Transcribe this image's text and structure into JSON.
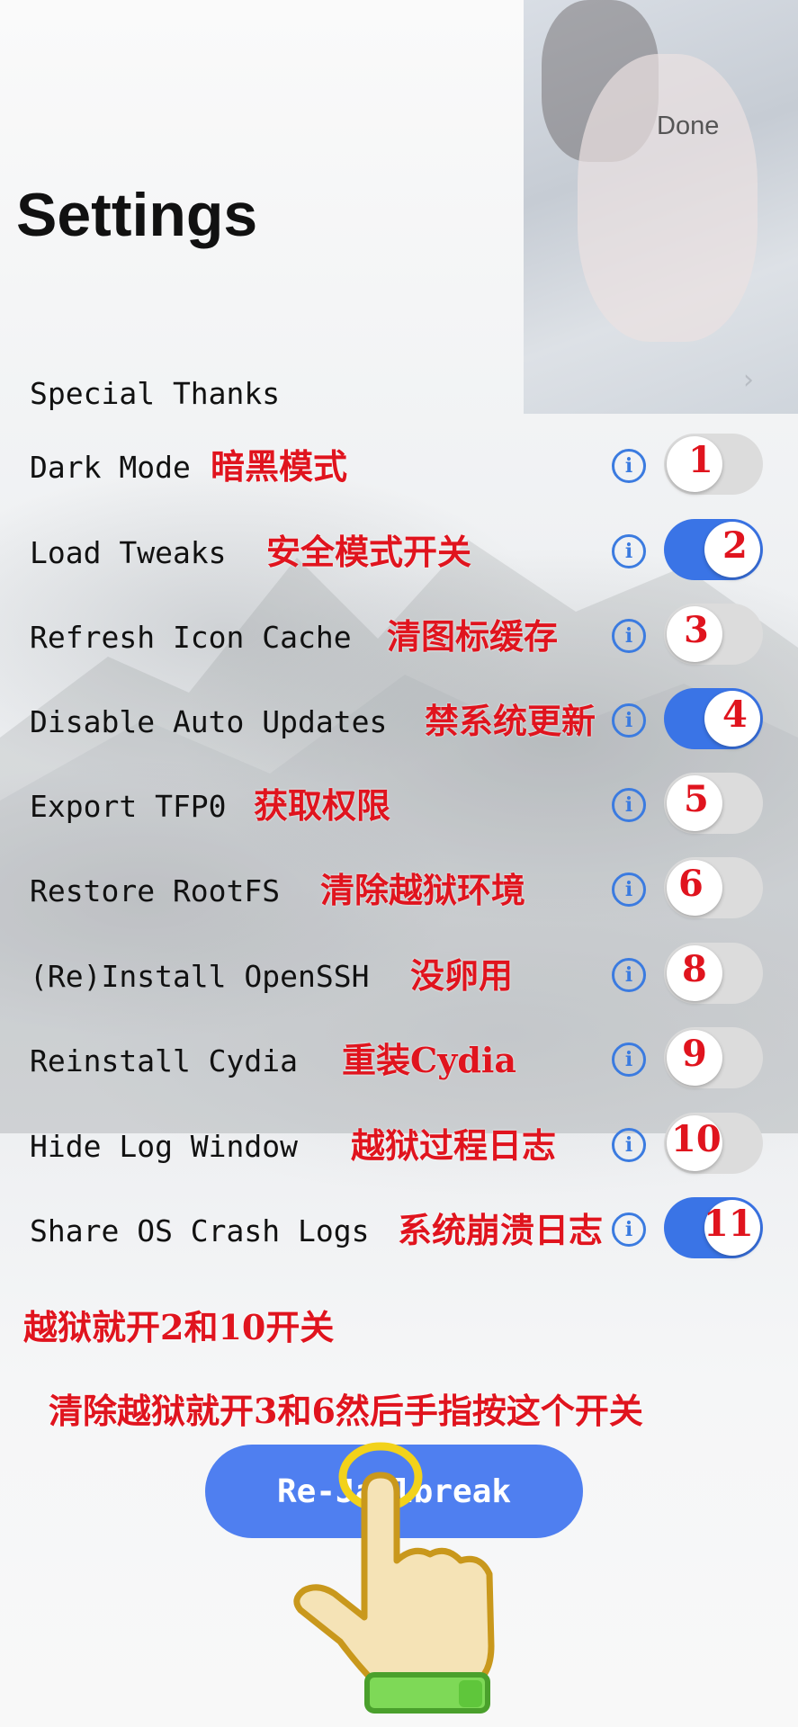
{
  "header": {
    "done_label": "Done",
    "title": "Settings"
  },
  "settings": {
    "special_thanks": "Special Thanks",
    "rows": [
      {
        "label": "Dark Mode",
        "note": "暗黑模式",
        "badge": "1",
        "on": false
      },
      {
        "label": "Load Tweaks",
        "note": "安全模式开关",
        "badge": "2",
        "on": true
      },
      {
        "label": "Refresh Icon Cache",
        "note": "清图标缓存",
        "badge": "3",
        "on": false
      },
      {
        "label": "Disable Auto Updates",
        "note": "禁系统更新",
        "badge": "4",
        "on": true
      },
      {
        "label": "Export TFP0",
        "note": "获取权限",
        "badge": "5",
        "on": false
      },
      {
        "label": "Restore RootFS",
        "note": "清除越狱环境",
        "badge": "6",
        "on": false
      },
      {
        "label": "(Re)Install OpenSSH",
        "note": "没卵用",
        "badge": "8",
        "on": false
      },
      {
        "label": "Reinstall Cydia",
        "note": "重装Cydia",
        "badge": "9",
        "on": false
      },
      {
        "label": "Hide Log Window",
        "note": "越狱过程日志",
        "badge": "10",
        "on": false
      },
      {
        "label": "Share OS Crash Logs",
        "note": "系统崩溃日志",
        "badge": "11",
        "on": true
      }
    ],
    "info_icon": "info-icon"
  },
  "instructions": {
    "line1": "越狱就开2和10开关",
    "line2": "清除越狱就开3和6然后手指按这个开关"
  },
  "action": {
    "rejailbreak_label": "Re-Jailbreak"
  },
  "colors": {
    "accent": "#3a74e6",
    "annotation": "#e0141e",
    "button": "#4f7ff0"
  }
}
